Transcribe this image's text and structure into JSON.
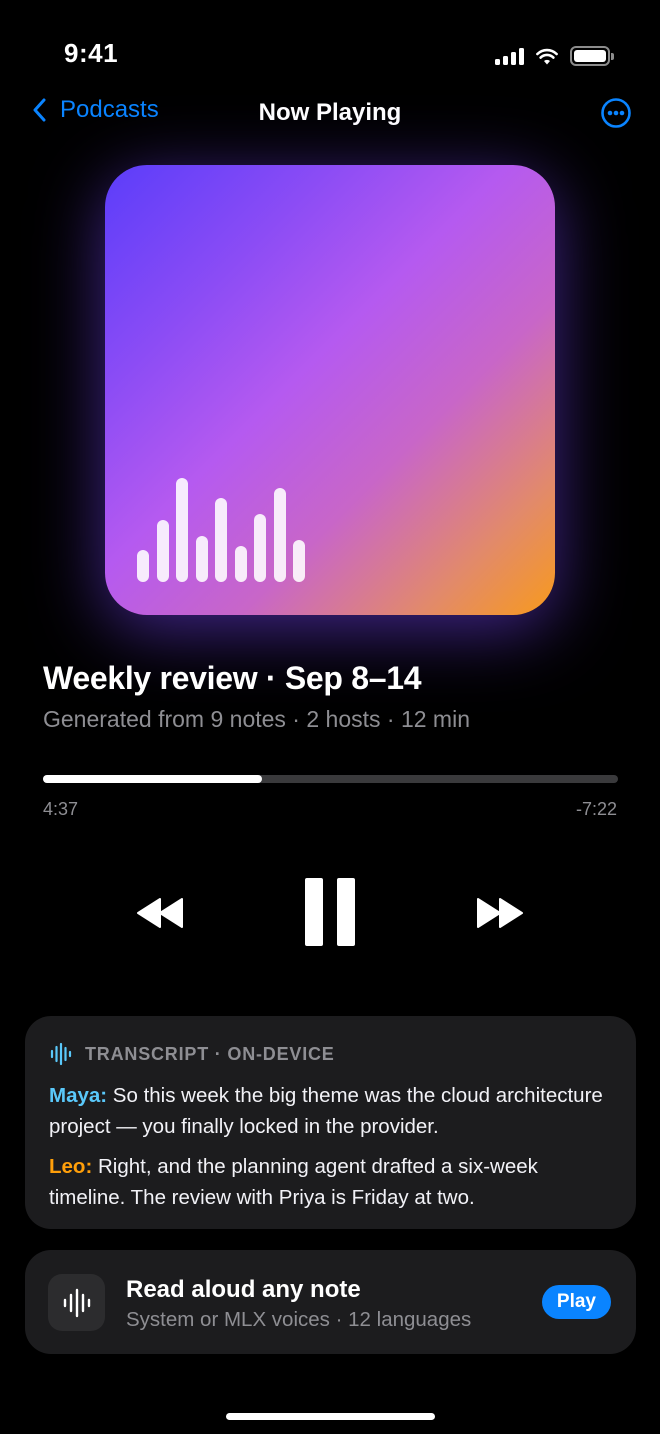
{
  "status_bar": {
    "time": "9:41"
  },
  "nav": {
    "back_label": "Podcasts",
    "title": "Now Playing"
  },
  "episode": {
    "title": "Weekly review · Sep 8–14",
    "subtitle": "Generated from 9 notes · 2 hosts · 12 min"
  },
  "playback": {
    "elapsed": "4:37",
    "remaining": "-7:22",
    "progress_fraction": 0.38,
    "state": "playing"
  },
  "transcript": {
    "header": "TRANSCRIPT · ON-DEVICE",
    "lines": [
      {
        "speaker": "Maya:",
        "text": " So this week the big theme was the cloud architecture project — you finally locked in the provider."
      },
      {
        "speaker": "Leo:",
        "text": " Right, and the planning agent drafted a six-week timeline. The review with Priya is Friday at two."
      }
    ]
  },
  "read_aloud": {
    "title": "Read aloud any note",
    "subtitle": "System or MLX voices · 12 languages",
    "button_label": "Play"
  },
  "colors": {
    "accent": "#0a84ff",
    "speaker_maya": "#5ac8fa",
    "speaker_leo": "#ff9f0a",
    "card_background": "#1c1c1e",
    "artwork_gradient_start": "#5b3dfa",
    "artwork_gradient_end": "#f89a1c"
  },
  "icons": {
    "back": "chevron-left-icon",
    "more": "ellipsis-circle-icon",
    "rewind": "backward-fill-icon",
    "pause": "pause-fill-icon",
    "forward": "forward-fill-icon",
    "transcript": "waveform-icon",
    "read_aloud": "waveform-icon"
  }
}
